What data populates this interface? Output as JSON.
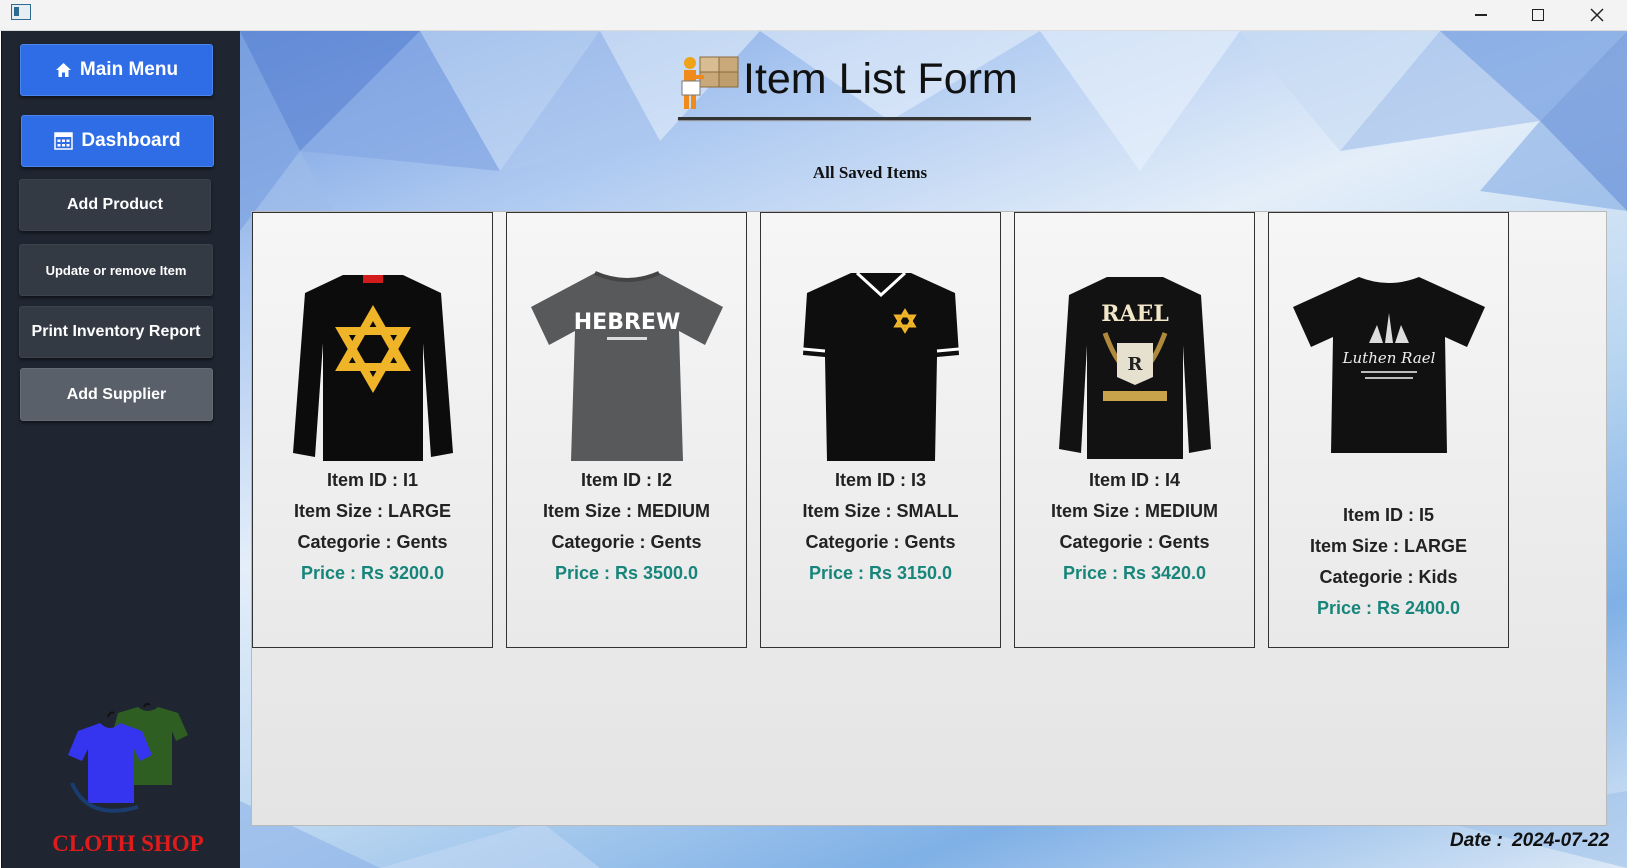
{
  "sidebar": {
    "main_menu": "Main Menu",
    "dashboard": "Dashboard",
    "add_product": "Add Product",
    "update_remove": "Update or remove Item",
    "print_report": "Print Inventory Report",
    "add_supplier": "Add Supplier",
    "logo_text": "CLOTH SHOP"
  },
  "header": {
    "title": "Item List Form",
    "subtitle": "All Saved Items"
  },
  "items": [
    {
      "id": "Item ID : I1",
      "size": "Item Size : LARGE",
      "category": "Categorie : Gents",
      "price": "Price : Rs 3200.0",
      "shirt_icon": "black-longsleeve-star-icon"
    },
    {
      "id": "Item ID : I2",
      "size": "Item Size : MEDIUM",
      "category": "Categorie : Gents",
      "price": "Price : Rs 3500.0",
      "shirt_icon": "grey-tshirt-hebrew-icon",
      "print_text": "HEBREW"
    },
    {
      "id": "Item ID : I3",
      "size": "Item Size : SMALL",
      "category": "Categorie : Gents",
      "price": "Price : Rs 3150.0",
      "shirt_icon": "black-polo-star-icon"
    },
    {
      "id": "Item ID : I4",
      "size": "Item Size : MEDIUM",
      "category": "Categorie : Gents",
      "price": "Price : Rs 3420.0",
      "shirt_icon": "black-longsleeve-rael-icon",
      "print_text": "RAEL"
    },
    {
      "id": "Item ID : I5",
      "size": "Item Size : LARGE",
      "category": "Categorie : Kids",
      "price": "Price : Rs 2400.0",
      "shirt_icon": "black-tshirt-castle-icon",
      "print_text": "Luthen Rael"
    }
  ],
  "footer": {
    "date_label": "Date :",
    "date_value": "2024-07-22"
  },
  "colors": {
    "sidebar_bg": "#1f2631",
    "primary_button": "#2f6de6",
    "price_text": "#17857a",
    "logo_text": "#e01b1b"
  }
}
